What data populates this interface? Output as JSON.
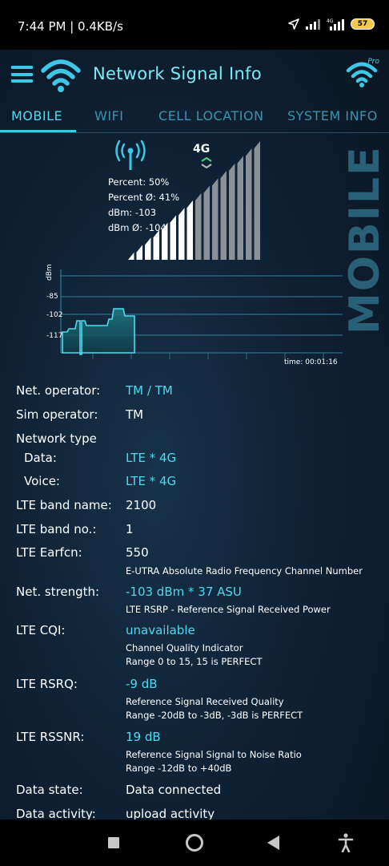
{
  "status": {
    "time": "7:44 PM | 0.4KB/s",
    "net_label": "4G",
    "battery": "57"
  },
  "header": {
    "title": "Network Signal Info",
    "pro_badge": "Pro"
  },
  "tabs": [
    {
      "label": "MOBILE",
      "active": true
    },
    {
      "label": "WIFI",
      "active": false
    },
    {
      "label": "CELL LOCATION",
      "active": false
    },
    {
      "label": "SYSTEM INFO",
      "active": false
    }
  ],
  "signal": {
    "side_label": "MOBILE",
    "net_badge": "4G",
    "percent": "Percent: 50%",
    "percent_avg": "Percent Ø: 41%",
    "dbm": "dBm: -103",
    "dbm_avg": "dBm Ø: -104",
    "bars_total": 16,
    "bars_filled": 8
  },
  "graph": {
    "y_unit": "dBm",
    "y_ticks": [
      "-85",
      "-102",
      "-117"
    ],
    "time_label": "time: 00:01:16"
  },
  "info": [
    {
      "label": "Net. operator:",
      "value": "TM / TM",
      "cyan": true
    },
    {
      "label": "Sim operator:",
      "value": "TM",
      "cyan": false
    },
    {
      "label": "Network type",
      "value": "",
      "cyan": false
    },
    {
      "label": "Data:",
      "value": "LTE * 4G",
      "cyan": true,
      "sub": true
    },
    {
      "label": "Voice:",
      "value": "LTE * 4G",
      "cyan": true,
      "sub": true
    },
    {
      "label": "LTE band name:",
      "value": "2100",
      "cyan": false
    },
    {
      "label": "LTE band no.:",
      "value": "1",
      "cyan": false
    },
    {
      "label": "LTE Earfcn:",
      "value": "550",
      "cyan": false,
      "notes": [
        "E-UTRA Absolute Radio Frequency Channel Number"
      ]
    },
    {
      "label": "Net. strength:",
      "value": "-103 dBm * 37 ASU",
      "cyan": true,
      "notes": [
        "LTE RSRP - Reference Signal Received Power"
      ]
    },
    {
      "label": "LTE CQI:",
      "value": "unavailable",
      "cyan": true,
      "notes": [
        "Channel Quality Indicator",
        "Range 0 to 15, 15 is PERFECT"
      ]
    },
    {
      "label": "LTE RSRQ:",
      "value": "-9 dB",
      "cyan": true,
      "notes": [
        "Reference Signal Received Quality",
        "Range -20dB to -3dB, -3dB is PERFECT"
      ]
    },
    {
      "label": "LTE RSSNR:",
      "value": "19 dB",
      "cyan": true,
      "notes": [
        "Reference Signal Signal to Noise Ratio",
        "Range -12dB to +40dB"
      ]
    },
    {
      "label": "Data state:",
      "value": "Data connected",
      "cyan": false
    },
    {
      "label": "Data activity:",
      "value": "upload activity",
      "cyan": false
    }
  ],
  "colors": {
    "accent": "#4fd9f0",
    "tab_inactive": "#3a94b0",
    "background": "#0f2236"
  }
}
